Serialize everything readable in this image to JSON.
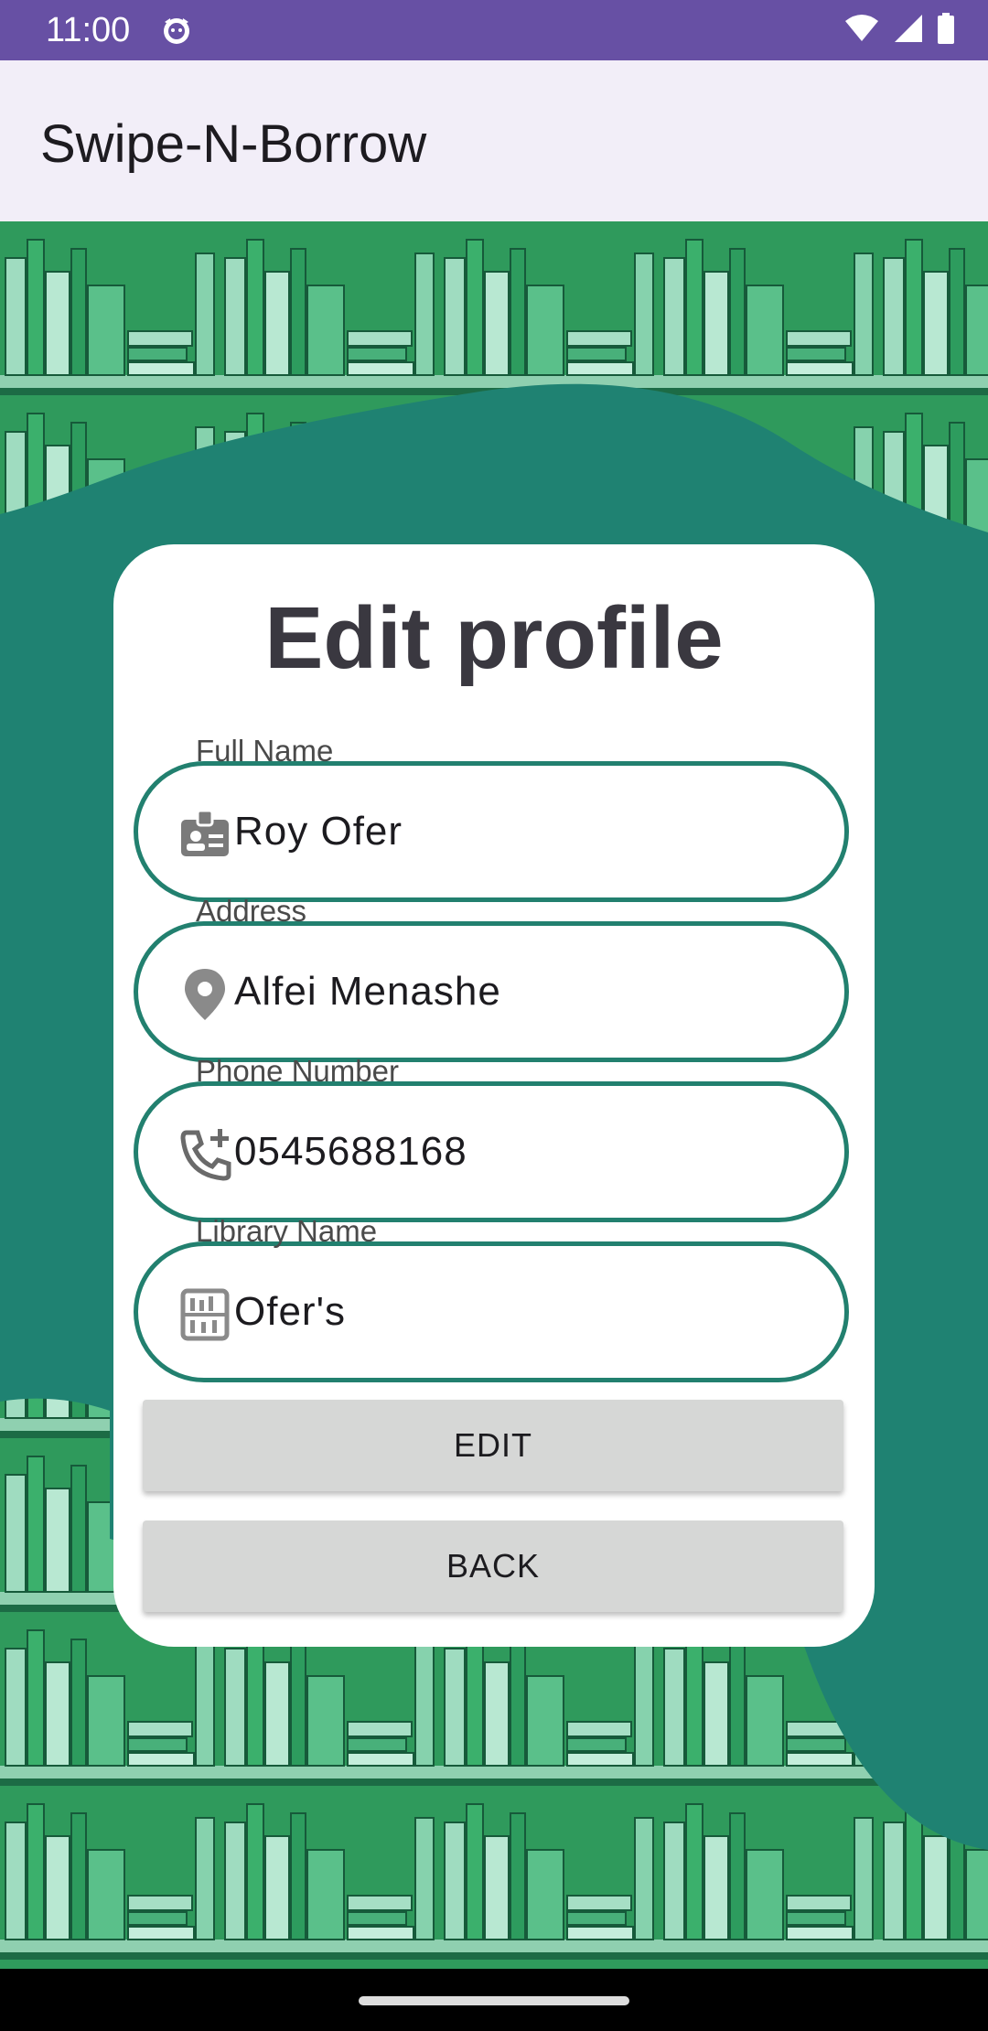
{
  "status_bar": {
    "time": "11:00"
  },
  "app_bar": {
    "title": "Swipe-N-Borrow"
  },
  "card": {
    "title": "Edit profile",
    "fields": [
      {
        "label": "Full Name",
        "value": "Roy Ofer",
        "icon": "badge-icon"
      },
      {
        "label": "Address",
        "value": "Alfei Menashe",
        "icon": "location-pin-icon"
      },
      {
        "label": "Phone Number",
        "value": "0545688168",
        "icon": "add-call-icon"
      },
      {
        "label": "Library Name",
        "value": "Ofer's",
        "icon": "library-icon"
      }
    ],
    "edit_button": "EDIT",
    "back_button": "BACK"
  },
  "colors": {
    "status_bar": "#6750a4",
    "app_bar": "#f2eef8",
    "field_outline": "#22806f",
    "background_teal": "#1f8272",
    "button": "#d6d7d6"
  }
}
